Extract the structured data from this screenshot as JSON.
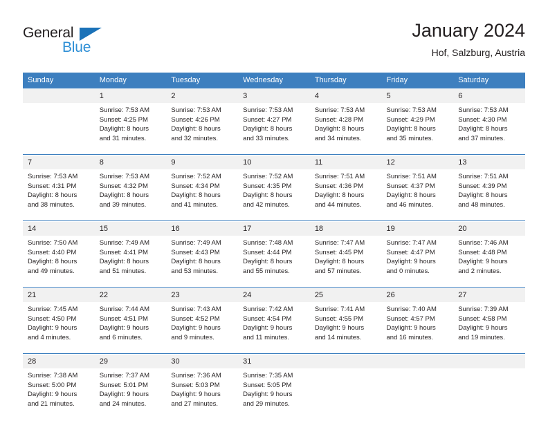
{
  "brand": {
    "name_part1": "General",
    "name_part2": "Blue",
    "accent_color": "#2e8fd6",
    "triangle_color": "#1b72b8"
  },
  "header": {
    "title": "January 2024",
    "subtitle": "Hof, Salzburg, Austria"
  },
  "calendar": {
    "header_bg": "#3d7fbf",
    "daynum_bg": "#f1f1f1",
    "weekday_labels": [
      "Sunday",
      "Monday",
      "Tuesday",
      "Wednesday",
      "Thursday",
      "Friday",
      "Saturday"
    ],
    "weeks": [
      [
        {
          "day": "",
          "l1": "",
          "l2": "",
          "l3": "",
          "l4": ""
        },
        {
          "day": "1",
          "l1": "Sunrise: 7:53 AM",
          "l2": "Sunset: 4:25 PM",
          "l3": "Daylight: 8 hours",
          "l4": "and 31 minutes."
        },
        {
          "day": "2",
          "l1": "Sunrise: 7:53 AM",
          "l2": "Sunset: 4:26 PM",
          "l3": "Daylight: 8 hours",
          "l4": "and 32 minutes."
        },
        {
          "day": "3",
          "l1": "Sunrise: 7:53 AM",
          "l2": "Sunset: 4:27 PM",
          "l3": "Daylight: 8 hours",
          "l4": "and 33 minutes."
        },
        {
          "day": "4",
          "l1": "Sunrise: 7:53 AM",
          "l2": "Sunset: 4:28 PM",
          "l3": "Daylight: 8 hours",
          "l4": "and 34 minutes."
        },
        {
          "day": "5",
          "l1": "Sunrise: 7:53 AM",
          "l2": "Sunset: 4:29 PM",
          "l3": "Daylight: 8 hours",
          "l4": "and 35 minutes."
        },
        {
          "day": "6",
          "l1": "Sunrise: 7:53 AM",
          "l2": "Sunset: 4:30 PM",
          "l3": "Daylight: 8 hours",
          "l4": "and 37 minutes."
        }
      ],
      [
        {
          "day": "7",
          "l1": "Sunrise: 7:53 AM",
          "l2": "Sunset: 4:31 PM",
          "l3": "Daylight: 8 hours",
          "l4": "and 38 minutes."
        },
        {
          "day": "8",
          "l1": "Sunrise: 7:53 AM",
          "l2": "Sunset: 4:32 PM",
          "l3": "Daylight: 8 hours",
          "l4": "and 39 minutes."
        },
        {
          "day": "9",
          "l1": "Sunrise: 7:52 AM",
          "l2": "Sunset: 4:34 PM",
          "l3": "Daylight: 8 hours",
          "l4": "and 41 minutes."
        },
        {
          "day": "10",
          "l1": "Sunrise: 7:52 AM",
          "l2": "Sunset: 4:35 PM",
          "l3": "Daylight: 8 hours",
          "l4": "and 42 minutes."
        },
        {
          "day": "11",
          "l1": "Sunrise: 7:51 AM",
          "l2": "Sunset: 4:36 PM",
          "l3": "Daylight: 8 hours",
          "l4": "and 44 minutes."
        },
        {
          "day": "12",
          "l1": "Sunrise: 7:51 AM",
          "l2": "Sunset: 4:37 PM",
          "l3": "Daylight: 8 hours",
          "l4": "and 46 minutes."
        },
        {
          "day": "13",
          "l1": "Sunrise: 7:51 AM",
          "l2": "Sunset: 4:39 PM",
          "l3": "Daylight: 8 hours",
          "l4": "and 48 minutes."
        }
      ],
      [
        {
          "day": "14",
          "l1": "Sunrise: 7:50 AM",
          "l2": "Sunset: 4:40 PM",
          "l3": "Daylight: 8 hours",
          "l4": "and 49 minutes."
        },
        {
          "day": "15",
          "l1": "Sunrise: 7:49 AM",
          "l2": "Sunset: 4:41 PM",
          "l3": "Daylight: 8 hours",
          "l4": "and 51 minutes."
        },
        {
          "day": "16",
          "l1": "Sunrise: 7:49 AM",
          "l2": "Sunset: 4:43 PM",
          "l3": "Daylight: 8 hours",
          "l4": "and 53 minutes."
        },
        {
          "day": "17",
          "l1": "Sunrise: 7:48 AM",
          "l2": "Sunset: 4:44 PM",
          "l3": "Daylight: 8 hours",
          "l4": "and 55 minutes."
        },
        {
          "day": "18",
          "l1": "Sunrise: 7:47 AM",
          "l2": "Sunset: 4:45 PM",
          "l3": "Daylight: 8 hours",
          "l4": "and 57 minutes."
        },
        {
          "day": "19",
          "l1": "Sunrise: 7:47 AM",
          "l2": "Sunset: 4:47 PM",
          "l3": "Daylight: 9 hours",
          "l4": "and 0 minutes."
        },
        {
          "day": "20",
          "l1": "Sunrise: 7:46 AM",
          "l2": "Sunset: 4:48 PM",
          "l3": "Daylight: 9 hours",
          "l4": "and 2 minutes."
        }
      ],
      [
        {
          "day": "21",
          "l1": "Sunrise: 7:45 AM",
          "l2": "Sunset: 4:50 PM",
          "l3": "Daylight: 9 hours",
          "l4": "and 4 minutes."
        },
        {
          "day": "22",
          "l1": "Sunrise: 7:44 AM",
          "l2": "Sunset: 4:51 PM",
          "l3": "Daylight: 9 hours",
          "l4": "and 6 minutes."
        },
        {
          "day": "23",
          "l1": "Sunrise: 7:43 AM",
          "l2": "Sunset: 4:52 PM",
          "l3": "Daylight: 9 hours",
          "l4": "and 9 minutes."
        },
        {
          "day": "24",
          "l1": "Sunrise: 7:42 AM",
          "l2": "Sunset: 4:54 PM",
          "l3": "Daylight: 9 hours",
          "l4": "and 11 minutes."
        },
        {
          "day": "25",
          "l1": "Sunrise: 7:41 AM",
          "l2": "Sunset: 4:55 PM",
          "l3": "Daylight: 9 hours",
          "l4": "and 14 minutes."
        },
        {
          "day": "26",
          "l1": "Sunrise: 7:40 AM",
          "l2": "Sunset: 4:57 PM",
          "l3": "Daylight: 9 hours",
          "l4": "and 16 minutes."
        },
        {
          "day": "27",
          "l1": "Sunrise: 7:39 AM",
          "l2": "Sunset: 4:58 PM",
          "l3": "Daylight: 9 hours",
          "l4": "and 19 minutes."
        }
      ],
      [
        {
          "day": "28",
          "l1": "Sunrise: 7:38 AM",
          "l2": "Sunset: 5:00 PM",
          "l3": "Daylight: 9 hours",
          "l4": "and 21 minutes."
        },
        {
          "day": "29",
          "l1": "Sunrise: 7:37 AM",
          "l2": "Sunset: 5:01 PM",
          "l3": "Daylight: 9 hours",
          "l4": "and 24 minutes."
        },
        {
          "day": "30",
          "l1": "Sunrise: 7:36 AM",
          "l2": "Sunset: 5:03 PM",
          "l3": "Daylight: 9 hours",
          "l4": "and 27 minutes."
        },
        {
          "day": "31",
          "l1": "Sunrise: 7:35 AM",
          "l2": "Sunset: 5:05 PM",
          "l3": "Daylight: 9 hours",
          "l4": "and 29 minutes."
        },
        {
          "day": "",
          "l1": "",
          "l2": "",
          "l3": "",
          "l4": ""
        },
        {
          "day": "",
          "l1": "",
          "l2": "",
          "l3": "",
          "l4": ""
        },
        {
          "day": "",
          "l1": "",
          "l2": "",
          "l3": "",
          "l4": ""
        }
      ]
    ]
  }
}
